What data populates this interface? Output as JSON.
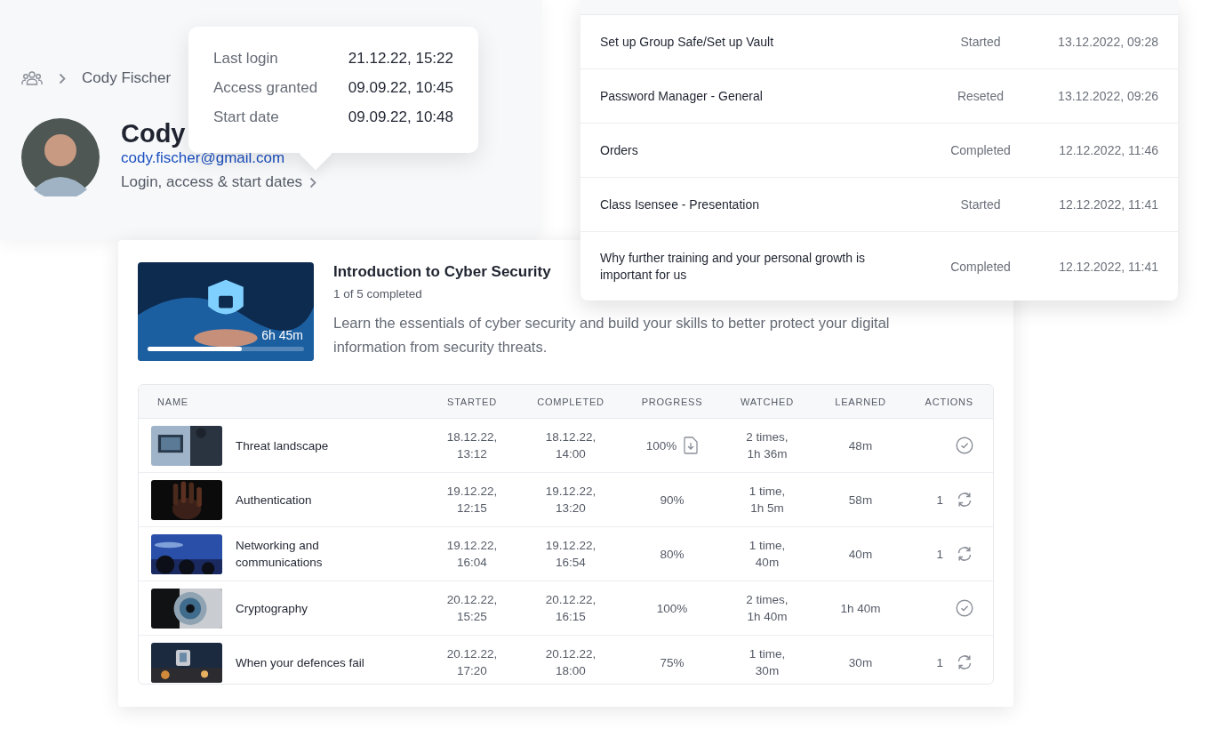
{
  "profile": {
    "breadcrumb": {
      "current": "Cody Fischer"
    },
    "name": "Cody",
    "email": "cody.fischer@gmail.com",
    "dates_link": "Login, access & start dates"
  },
  "dates_popover": {
    "rows": [
      {
        "label": "Last login",
        "value": "21.12.22, 15:22"
      },
      {
        "label": "Access granted",
        "value": "09.09.22, 10:45"
      },
      {
        "label": "Start date",
        "value": "09.09.22, 10:48"
      }
    ]
  },
  "lectures": {
    "rows": [
      {
        "lecture": "Set up Group Safe/Set up Vault",
        "state": "Started",
        "date": "13.12.2022, 09:28"
      },
      {
        "lecture": "Password Manager - General",
        "state": "Reseted",
        "date": "13.12.2022, 09:26"
      },
      {
        "lecture": "Orders",
        "state": "Completed",
        "date": "12.12.2022, 11:46"
      },
      {
        "lecture": "Class Isensee - Presentation",
        "state": "Started",
        "date": "12.12.2022, 11:41"
      },
      {
        "lecture": "Why further training and your personal growth is important for us",
        "state": "Completed",
        "date": "12.12.2022, 11:41"
      }
    ]
  },
  "course": {
    "title": "Introduction to Cyber Security",
    "completed": "1 of 5 completed",
    "description": "Learn the essentials of cyber security and build your skills to better protect your digital information from security threats.",
    "thumbnail": {
      "kind": "picture",
      "duration": "6h 45m",
      "level": 0.6
    },
    "table": {
      "columns": [
        "NAME",
        "STARTED",
        "COMPLETED",
        "PROGRESS",
        "WATCHED",
        "LEARNED",
        "ACTIONS"
      ],
      "rows": [
        {
          "name": "Threat landscape",
          "started": "18.12.22,\n13:12",
          "completed": "18.12.22,\n14:00",
          "progress": "100%",
          "certificate": true,
          "watched": "2 times,\n1h 36m",
          "learned": "48m",
          "action": {
            "kind": "done"
          }
        },
        {
          "name": "Authentication",
          "started": "19.12.22,\n12:15",
          "completed": "19.12.22,\n13:20",
          "progress": "90%",
          "certificate": false,
          "watched": "1 time,\n1h 5m",
          "learned": "58m",
          "action": {
            "kind": "reset",
            "count": "1"
          }
        },
        {
          "name": "Networking and\ncommunications",
          "started": "19.12.22,\n16:04",
          "completed": "19.12.22,\n16:54",
          "progress": "80%",
          "certificate": false,
          "watched": "1 time,\n40m",
          "learned": "40m",
          "action": {
            "kind": "reset",
            "count": "1"
          }
        },
        {
          "name": "Cryptography",
          "started": "20.12.22,\n15:25",
          "completed": "20.12.22,\n16:15",
          "progress": "100%",
          "certificate": false,
          "watched": "2 times,\n1h 40m",
          "learned": "1h 40m",
          "action": {
            "kind": "done"
          }
        },
        {
          "name": "When your defences fail",
          "started": "20.12.22,\n17:20",
          "completed": "20.12.22,\n18:00",
          "progress": "75%",
          "certificate": false,
          "watched": "1 time,\n30m",
          "learned": "30m",
          "action": {
            "kind": "reset",
            "count": "1"
          }
        }
      ]
    }
  }
}
